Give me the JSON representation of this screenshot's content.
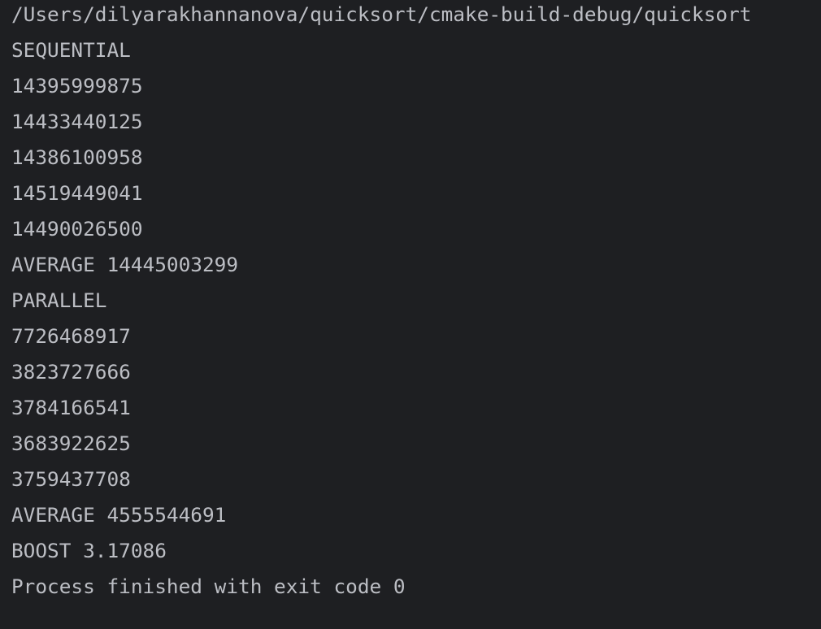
{
  "console": {
    "lines": [
      "/Users/dilyarakhannanova/quicksort/cmake-build-debug/quicksort",
      "SEQUENTIAL",
      "14395999875",
      "14433440125",
      "14386100958",
      "14519449041",
      "14490026500",
      "AVERAGE 14445003299",
      "PARALLEL",
      "7726468917",
      "3823727666",
      "3784166541",
      "3683922625",
      "3759437708",
      "AVERAGE 4555544691",
      "BOOST 3.17086",
      "Process finished with exit code 0"
    ]
  },
  "colors": {
    "background": "#1e1f22",
    "text": "#bcbec4"
  }
}
